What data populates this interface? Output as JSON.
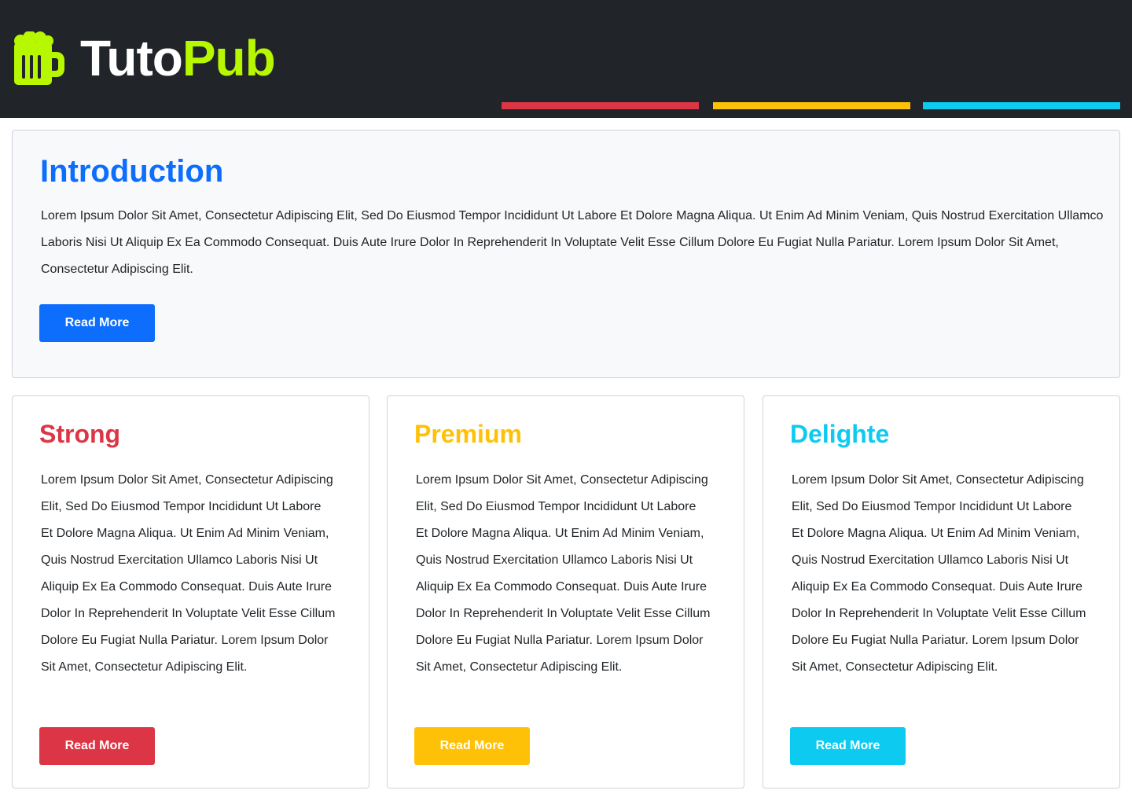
{
  "header": {
    "logo_icon": "beer-mug-icon",
    "brand_part1": "Tuto",
    "brand_part2": "Pub",
    "brand_colors": {
      "part1": "#ffffff",
      "part2": "#b7f700"
    },
    "background": "#212529",
    "stripe_colors": [
      "#dc3545",
      "#ffc107",
      "#0dcaf0"
    ]
  },
  "intro": {
    "title": "Introduction",
    "text": "Lorem Ipsum Dolor Sit Amet, Consectetur Adipiscing Elit, Sed Do Eiusmod Tempor Incididunt Ut Labore Et Dolore Magna Aliqua. Ut Enim Ad Minim Veniam, Quis Nostrud Exercitation Ullamco Laboris Nisi Ut Aliquip Ex Ea Commodo Consequat. Duis Aute Irure Dolor In Reprehenderit In Voluptate Velit Esse Cillum Dolore Eu Fugiat Nulla Pariatur. Lorem Ipsum Dolor Sit Amet, Consectetur Adipiscing Elit.",
    "button_label": "Read More",
    "accent": "#0d6efd"
  },
  "cards": [
    {
      "title": "Strong",
      "text": "Lorem Ipsum Dolor Sit Amet, Consectetur Adipiscing Elit, Sed Do Eiusmod Tempor Incididunt Ut Labore Et Dolore Magna Aliqua. Ut Enim Ad Minim Veniam, Quis Nostrud Exercitation Ullamco Laboris Nisi Ut Aliquip Ex Ea Commodo Consequat. Duis Aute Irure Dolor In Reprehenderit In Voluptate Velit Esse Cillum Dolore Eu Fugiat Nulla Pariatur. Lorem Ipsum Dolor Sit Amet, Consectetur Adipiscing Elit.",
      "button_label": "Read More",
      "accent": "#dc3545"
    },
    {
      "title": "Premium",
      "text": "Lorem Ipsum Dolor Sit Amet, Consectetur Adipiscing Elit, Sed Do Eiusmod Tempor Incididunt Ut Labore Et Dolore Magna Aliqua. Ut Enim Ad Minim Veniam, Quis Nostrud Exercitation Ullamco Laboris Nisi Ut Aliquip Ex Ea Commodo Consequat. Duis Aute Irure Dolor In Reprehenderit In Voluptate Velit Esse Cillum Dolore Eu Fugiat Nulla Pariatur. Lorem Ipsum Dolor Sit Amet, Consectetur Adipiscing Elit.",
      "button_label": "Read More",
      "accent": "#ffc107"
    },
    {
      "title": "Delighte",
      "text": "Lorem Ipsum Dolor Sit Amet, Consectetur Adipiscing Elit, Sed Do Eiusmod Tempor Incididunt Ut Labore Et Dolore Magna Aliqua. Ut Enim Ad Minim Veniam, Quis Nostrud Exercitation Ullamco Laboris Nisi Ut Aliquip Ex Ea Commodo Consequat. Duis Aute Irure Dolor In Reprehenderit In Voluptate Velit Esse Cillum Dolore Eu Fugiat Nulla Pariatur. Lorem Ipsum Dolor Sit Amet, Consectetur Adipiscing Elit.",
      "button_label": "Read More",
      "accent": "#0dcaf0"
    }
  ]
}
